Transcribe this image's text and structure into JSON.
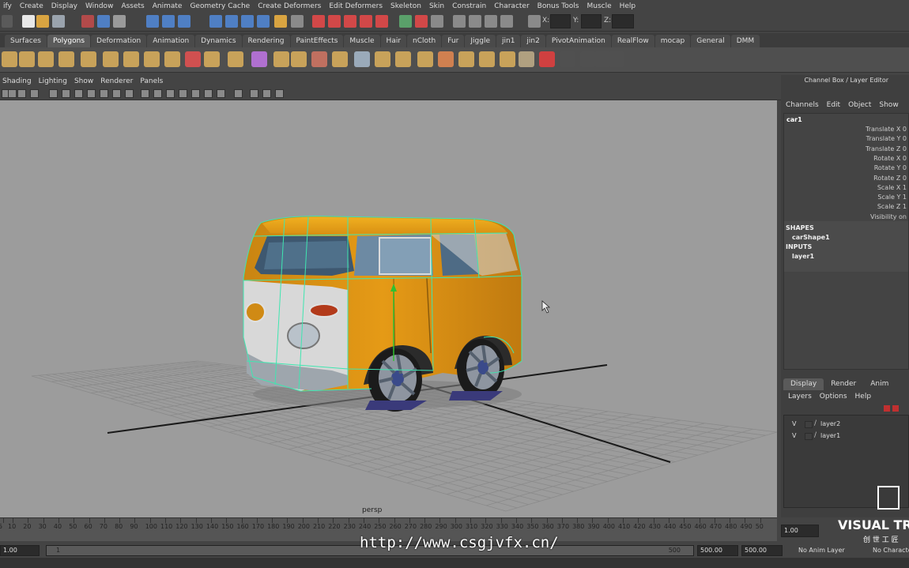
{
  "menubar": [
    "ify",
    "Create",
    "Display",
    "Window",
    "Assets",
    "Animate",
    "Geometry Cache",
    "Create Deformers",
    "Edit Deformers",
    "Skeleton",
    "Skin",
    "Constrain",
    "Character",
    "Bonus Tools",
    "Muscle",
    "Help"
  ],
  "statusline": {
    "x_label": "X:",
    "y_label": "Y:",
    "z_label": "Z:"
  },
  "shelf_tabs": [
    "Surfaces",
    "Polygons",
    "Deformation",
    "Animation",
    "Dynamics",
    "Rendering",
    "PaintEffects",
    "Muscle",
    "Hair",
    "nCloth",
    "Fur",
    "Jiggle",
    "jin1",
    "jin2",
    "PivotAnimation",
    "RealFlow",
    "mocap",
    "General",
    "DMM"
  ],
  "shelf_active": "Polygons",
  "panel_menu": [
    "Shading",
    "Lighting",
    "Show",
    "Renderer",
    "Panels"
  ],
  "viewport": {
    "camera": "persp"
  },
  "channel_box": {
    "title": "Channel Box / Layer Editor",
    "menu": [
      "Channels",
      "Edit",
      "Object",
      "Show"
    ],
    "object": "car1",
    "attributes": [
      "Translate X 0",
      "Translate Y 0",
      "Translate Z 0",
      "Rotate X 0",
      "Rotate Y 0",
      "Rotate Z 0",
      "Scale X 1",
      "Scale Y 1",
      "Scale Z 1",
      "Visibility on"
    ],
    "shapes_header": "SHAPES",
    "shape": "carShape1",
    "inputs_header": "INPUTS",
    "input": "layer1"
  },
  "layer_editor": {
    "tabs": [
      "Display",
      "Render",
      "Anim"
    ],
    "menu": [
      "Layers",
      "Options",
      "Help"
    ],
    "layers": [
      {
        "vis": "V",
        "name": "layer2"
      },
      {
        "vis": "V",
        "name": "layer1"
      }
    ]
  },
  "timeline": {
    "ticks": [
      "5",
      "10",
      "20",
      "30",
      "40",
      "50",
      "60",
      "70",
      "80",
      "90",
      "100",
      "110",
      "120",
      "130",
      "140",
      "150",
      "160",
      "170",
      "180",
      "190",
      "200",
      "210",
      "220",
      "230",
      "240",
      "250",
      "260",
      "270",
      "280",
      "290",
      "300",
      "310",
      "320",
      "330",
      "340",
      "350",
      "360",
      "370",
      "380",
      "390",
      "400",
      "410",
      "420",
      "430",
      "440",
      "450",
      "460",
      "470",
      "480",
      "490",
      "50"
    ],
    "current_frame": "1.00"
  },
  "range": {
    "start": "1.00",
    "inner_start": "1",
    "inner_end": "500",
    "end1": "500.00",
    "end2": "500.00",
    "anim_layer": "No Anim Layer",
    "character": "No Characte"
  },
  "watermark": "http://www.csgjvfx.cn/",
  "logo_text": "VISUAL TR",
  "logo_sub": "创 世 工 匠"
}
